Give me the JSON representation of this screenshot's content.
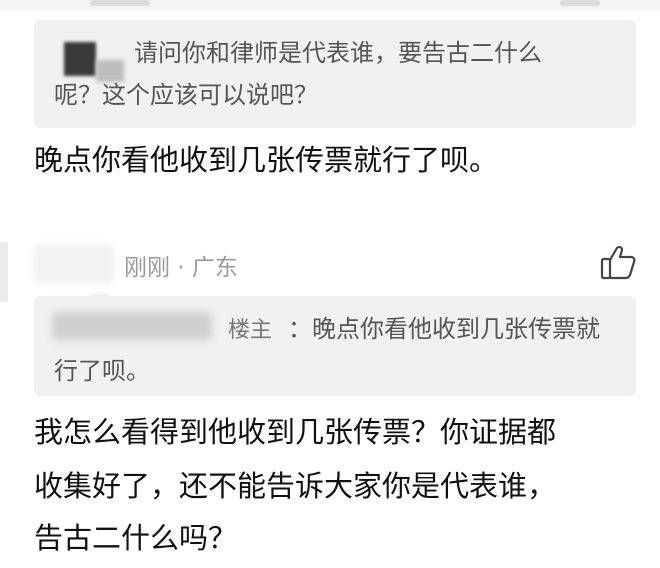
{
  "first_comment": {
    "quote_line1": "请问你和律师是代表谁，要告古二什么",
    "quote_line2": "呢？这个应该可以说吧？",
    "reply_text": "晚点你看他收到几张传票就行了呗。"
  },
  "second_comment": {
    "meta": "刚刚 · 广东",
    "like_icon": "thumbs-up-icon",
    "quote_author_badge": "楼主",
    "quote_line1": "：晚点你看他收到几张传票就",
    "quote_line2": "行了呗。",
    "body_line1": "我怎么看得到他收到几张传票？你证据都",
    "body_line2": "收集好了，还不能告诉大家你是代表谁，",
    "body_line3": "告古二什么吗？"
  }
}
